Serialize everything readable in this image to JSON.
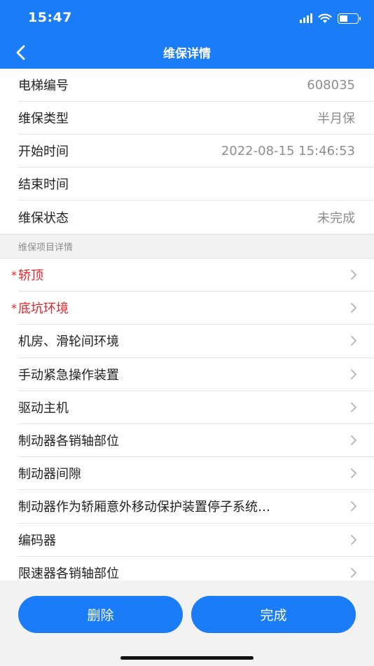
{
  "status_bar": {
    "time": "15:47",
    "battery_level": 0.45
  },
  "nav": {
    "title": "维保详情"
  },
  "info": [
    {
      "label": "电梯编号",
      "value": "608035"
    },
    {
      "label": "维保类型",
      "value": "半月保"
    },
    {
      "label": "开始时间",
      "value": "2022-08-15 15:46:53"
    },
    {
      "label": "结束时间",
      "value": ""
    },
    {
      "label": "维保状态",
      "value": "未完成"
    }
  ],
  "section": {
    "title": "维保项目详情"
  },
  "items": [
    {
      "label": "轿顶",
      "required": true
    },
    {
      "label": "底坑环境",
      "required": true
    },
    {
      "label": "机房、滑轮间环境",
      "required": false
    },
    {
      "label": "手动紧急操作装置",
      "required": false
    },
    {
      "label": "驱动主机",
      "required": false
    },
    {
      "label": "制动器各销轴部位",
      "required": false
    },
    {
      "label": "制动器间隙",
      "required": false
    },
    {
      "label": "制动器作为轿厢意外移动保护装置停子系统…",
      "required": false
    },
    {
      "label": "编码器",
      "required": false
    },
    {
      "label": "限速器各销轴部位",
      "required": false
    }
  ],
  "required_mark": "*",
  "buttons": {
    "delete": "删除",
    "finish": "完成"
  },
  "colors": {
    "primary": "#1a7cf7",
    "required": "#e8242a"
  }
}
